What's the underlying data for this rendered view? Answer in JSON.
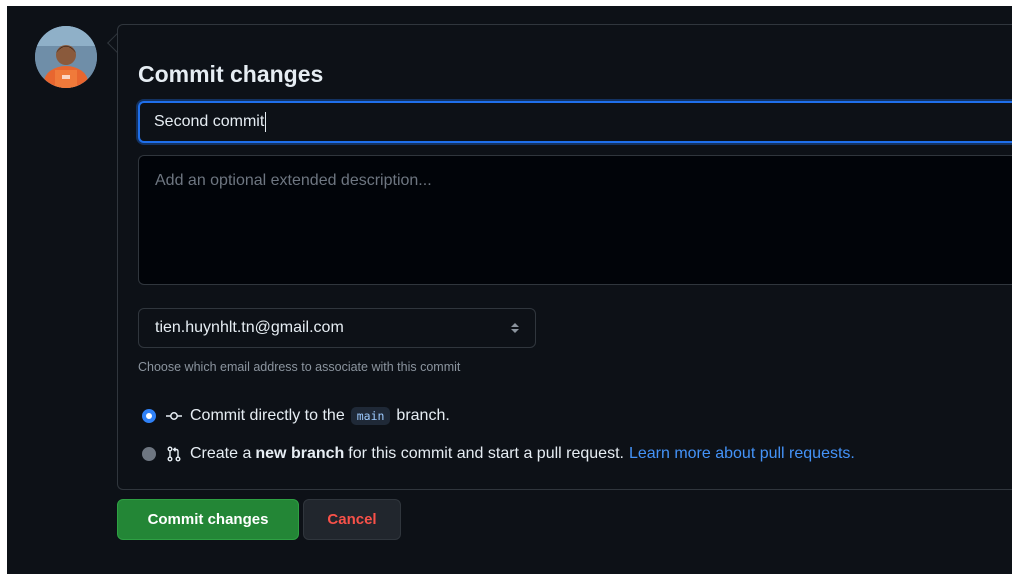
{
  "form": {
    "title": "Commit changes",
    "summary_value": "Second commit",
    "description_placeholder": "Add an optional extended description...",
    "email_value": "tien.huynhlt.tn@gmail.com",
    "email_note": "Choose which email address to associate with this commit"
  },
  "options": {
    "direct": {
      "prefix": "Commit directly to the",
      "branch": "main",
      "suffix": "branch."
    },
    "new_branch": {
      "prefix": "Create a",
      "emphasis": "new branch",
      "suffix": "for this commit and start a pull request.",
      "link": "Learn more about pull requests."
    }
  },
  "actions": {
    "commit_label": "Commit changes",
    "cancel_label": "Cancel"
  },
  "icons": {
    "direct": "git-commit-icon",
    "new_branch": "git-pull-request-icon",
    "email_select": "select-arrows-icon"
  },
  "colors": {
    "background": "#0d1117",
    "primary_button": "#238636",
    "cancel_text": "#f85149",
    "link": "#4493f8",
    "focus_border": "#1f6feb"
  }
}
